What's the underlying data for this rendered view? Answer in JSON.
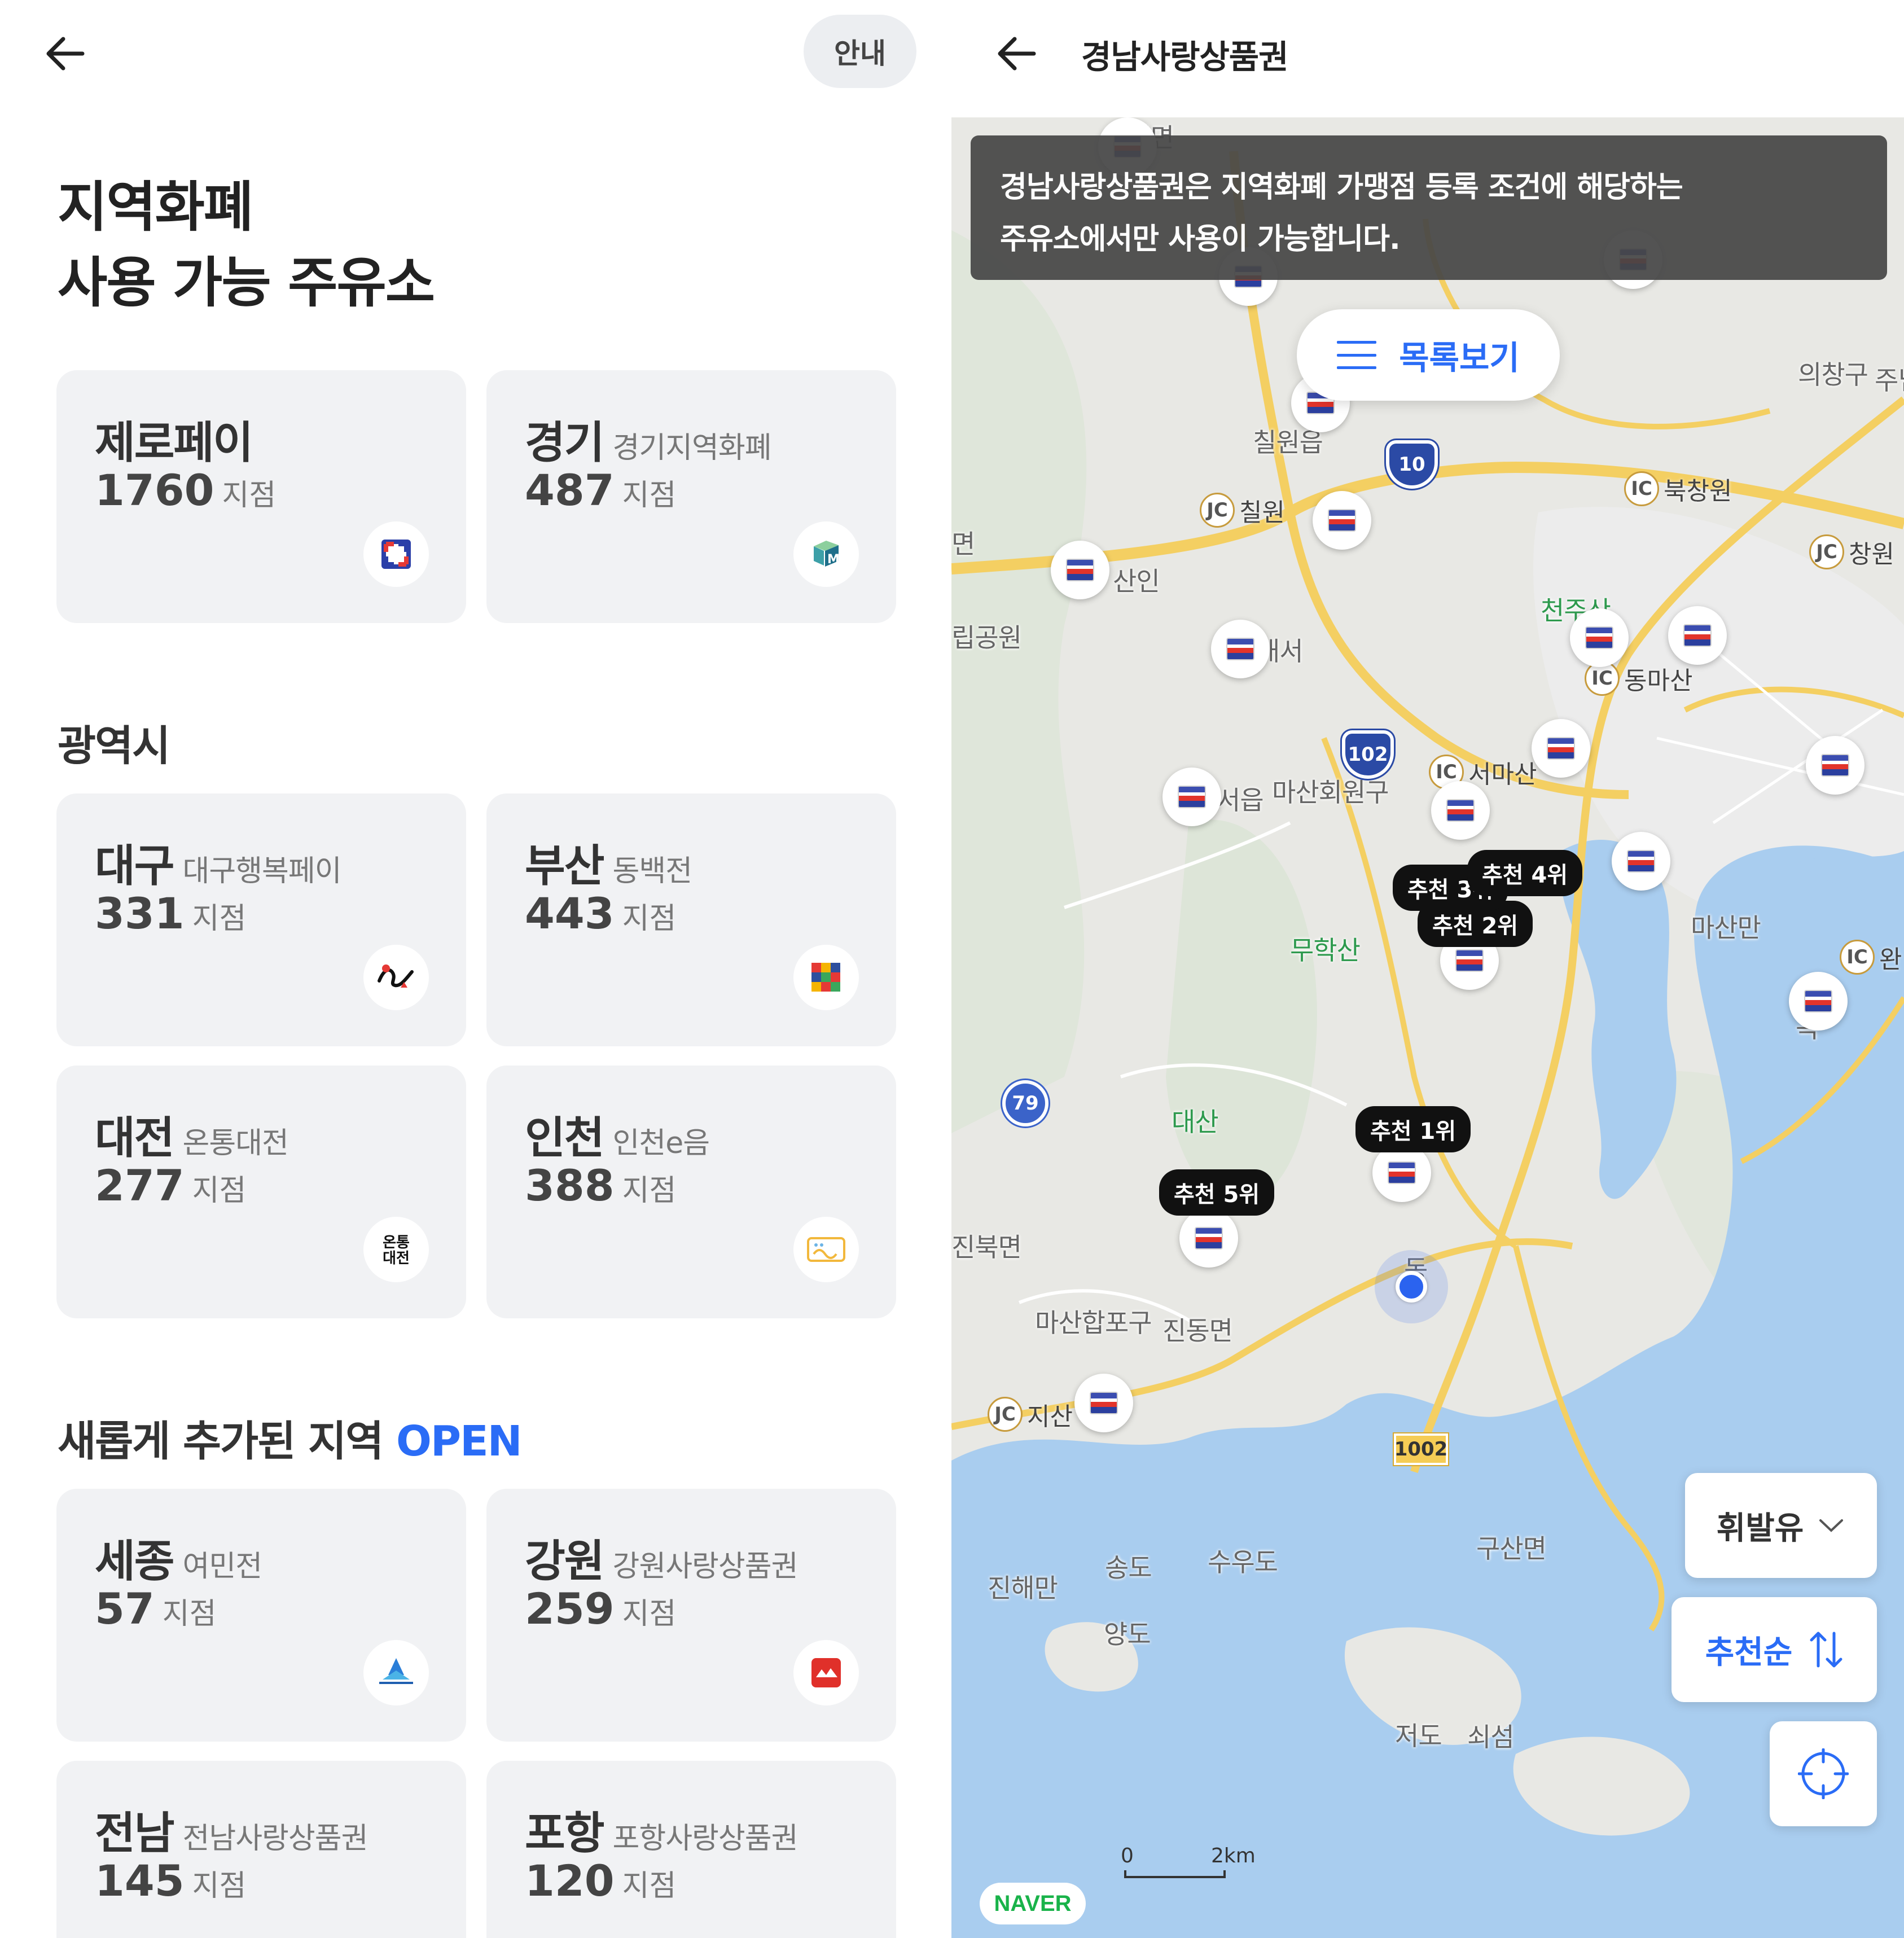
{
  "left": {
    "guide_label": "안내",
    "title_line1": "지역화폐",
    "title_line2": "사용 가능 주유소",
    "featured": [
      {
        "name": "제로페이",
        "sub": "",
        "count": "1760",
        "unit": "지점",
        "logo": "zeropay-logo"
      },
      {
        "name": "경기",
        "sub": "경기지역화폐",
        "count": "487",
        "unit": "지점",
        "logo": "gyeonggi-logo"
      }
    ],
    "metro_title": "광역시",
    "metro": [
      {
        "name": "대구",
        "sub": "대구행복페이",
        "count": "331",
        "unit": "지점",
        "logo": "daegu-logo"
      },
      {
        "name": "부산",
        "sub": "동백전",
        "count": "443",
        "unit": "지점",
        "logo": "busan-logo"
      },
      {
        "name": "대전",
        "sub": "온통대전",
        "count": "277",
        "unit": "지점",
        "logo": "daejeon-logo",
        "logo_text": "온통\n대전"
      },
      {
        "name": "인천",
        "sub": "인천e음",
        "count": "388",
        "unit": "지점",
        "logo": "incheon-logo"
      }
    ],
    "new_title": "새롭게 추가된 지역",
    "new_badge": "OPEN",
    "new_regions": [
      {
        "name": "세종",
        "sub": "여민전",
        "count": "57",
        "unit": "지점",
        "logo": "sejong-logo"
      },
      {
        "name": "강원",
        "sub": "강원사랑상품권",
        "count": "259",
        "unit": "지점",
        "logo": "gangwon-logo"
      },
      {
        "name": "전남",
        "sub": "전남사랑상품권",
        "count": "145",
        "unit": "지점",
        "logo": "jeonnam-logo"
      },
      {
        "name": "포항",
        "sub": "포항사랑상품권",
        "count": "120",
        "unit": "지점",
        "logo": "pohang-logo"
      }
    ]
  },
  "right": {
    "title": "경남사랑상품권",
    "notice_line1": "경남사랑상품권은 지역화폐 가맹점 등록 조건에 해당하는",
    "notice_line2": "주유소에서만 사용이 가능합니다.",
    "list_button": "목록보기",
    "fuel_select": "휘발유",
    "sort_label": "추천순",
    "ranks": [
      "추천 1위",
      "추천 2위",
      "추천 3위",
      "추천 4위",
      "추천 5위"
    ],
    "places": {
      "chilseo": "칠서면",
      "chilwon_eup": "칠원읍",
      "chilwon_jc": "칠원",
      "bukchangwon": "북창원",
      "uichang": "의창구",
      "juin": "주님",
      "changwon_jc": "창원",
      "naeseo": "내서",
      "sanin": "산인",
      "cheonjusan": "천주산",
      "dongmasan": "동마산",
      "seomasan": "서마산",
      "seoeup": "서읍",
      "masanhoewon": "마산회원구",
      "muhaksan": "무학산",
      "masanman": "마산만",
      "wan": "완",
      "daesan": "대산",
      "jinbuk": "진북면",
      "masanhappo": "마산합포구",
      "jindong": "진동면",
      "jisan": "지산",
      "gusan": "구산면",
      "jinhaeman": "진해만",
      "songdo": "송도",
      "suudo": "수우도",
      "yangdo": "양도",
      "jeodo": "저도",
      "soeseom": "쇠섬",
      "park": "립공원",
      "myeon": "면",
      "dong": "동",
      "gok": "곡"
    },
    "route_numbers": {
      "r10": "10",
      "r102": "102",
      "r79": "79",
      "r1002": "1002"
    },
    "scale_start": "0",
    "scale_end": "2km",
    "naver": "NAVER"
  }
}
